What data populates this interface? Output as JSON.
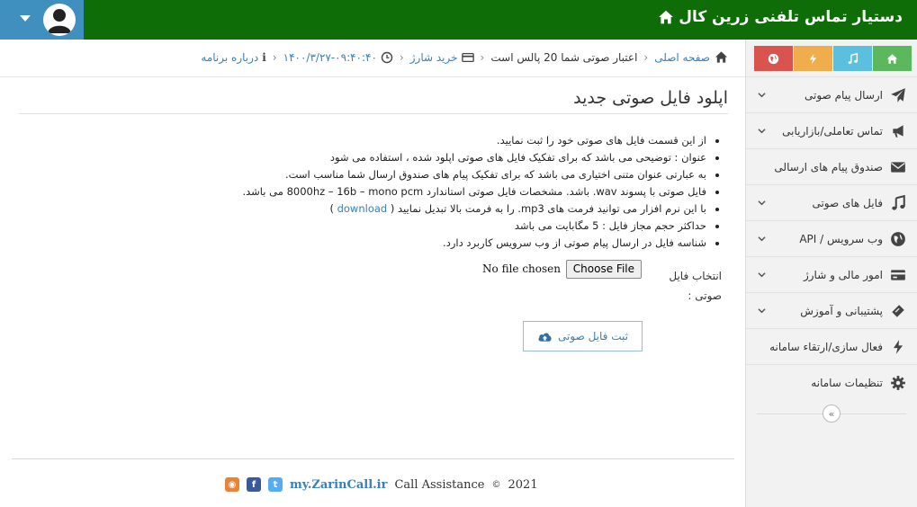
{
  "app": {
    "title": "دستیار تماس تلفنی زرین کال"
  },
  "colors": {
    "topbar": "#0f6d07",
    "userbox": "#3f8fbf",
    "link": "#3a7fb8",
    "shortcut_home": "#5cb85c",
    "shortcut_music": "#5bc0de",
    "shortcut_bolt": "#f0ad4e",
    "shortcut_globe": "#d9534f"
  },
  "breadcrumb": {
    "home": "صفحه اصلی",
    "credit": "اعتبار صوتی شما 20 پالس است",
    "buy": "خرید شارژ",
    "datetime": "۱۴۰۰/۳/۲۷-۰۹:۴۰:۴۰",
    "about": "درباره برنامه"
  },
  "sidebar": {
    "shortcuts": [
      "home-icon",
      "music-icon",
      "bolt-icon",
      "globe-icon"
    ],
    "items": [
      {
        "label": "ارسال پیام صوتی",
        "icon": "paper-plane-icon",
        "expandable": true
      },
      {
        "label": "تماس تعاملی/بازاریابی",
        "icon": "bullhorn-icon",
        "expandable": true
      },
      {
        "label": "صندوق پیام های ارسالی",
        "icon": "envelope-icon",
        "expandable": false
      },
      {
        "label": "فایل های صوتی",
        "icon": "music-icon",
        "expandable": true
      },
      {
        "label": "وب سرویس / API",
        "icon": "globe-icon",
        "expandable": true
      },
      {
        "label": "امور مالی و شارژ",
        "icon": "credit-card-icon",
        "expandable": true
      },
      {
        "label": "پشتیبانی و آموزش",
        "icon": "ticket-icon",
        "expandable": true
      },
      {
        "label": "فعال سازی/ارتقاء سامانه",
        "icon": "bolt-icon",
        "expandable": false
      },
      {
        "label": "تنظیمات سامانه",
        "icon": "gear-icon",
        "expandable": false
      }
    ],
    "collapse_glyph": "«"
  },
  "main": {
    "title": "اپلود فایل صوتی جدید",
    "rules": [
      "از این قسمت فایل های صوتی خود را ثبت نمایید.",
      "عنوان : توضیحی می باشد که برای تفکیک فایل های صوتی اپلود شده ، استفاده می شود",
      "به عبارتی عنوان متنی اختیاری می باشد که برای تفکیک پیام های صندوق ارسال شما مناسب است.",
      "فایل صوتی با پسوند wav. باشد. مشخصات فایل صوتی استاندارد 8000hz – 16b – mono pcm می باشد.",
      "با این نرم افزار می توانید فرمت های mp3. را به فرمت بالا تبدیل نمایید (",
      "حداکثر حجم مجاز فایل : 5 مگابایت  می باشد",
      "شناسه فایل در ارسال پیام صوتی از وب سرویس کاربرد دارد."
    ],
    "download_label": "download",
    "download_close": ")",
    "file_label": "انتخاب فایل صوتی :",
    "file_button": "Choose File",
    "file_status": "No file chosen",
    "submit_label": "ثبت فایل صوتی"
  },
  "footer": {
    "year": "2021",
    "copyright": "©",
    "product": "Call Assistance",
    "site": "my.ZarinCall.ir",
    "social": [
      "twitter-icon",
      "facebook-icon",
      "rss-icon"
    ]
  }
}
